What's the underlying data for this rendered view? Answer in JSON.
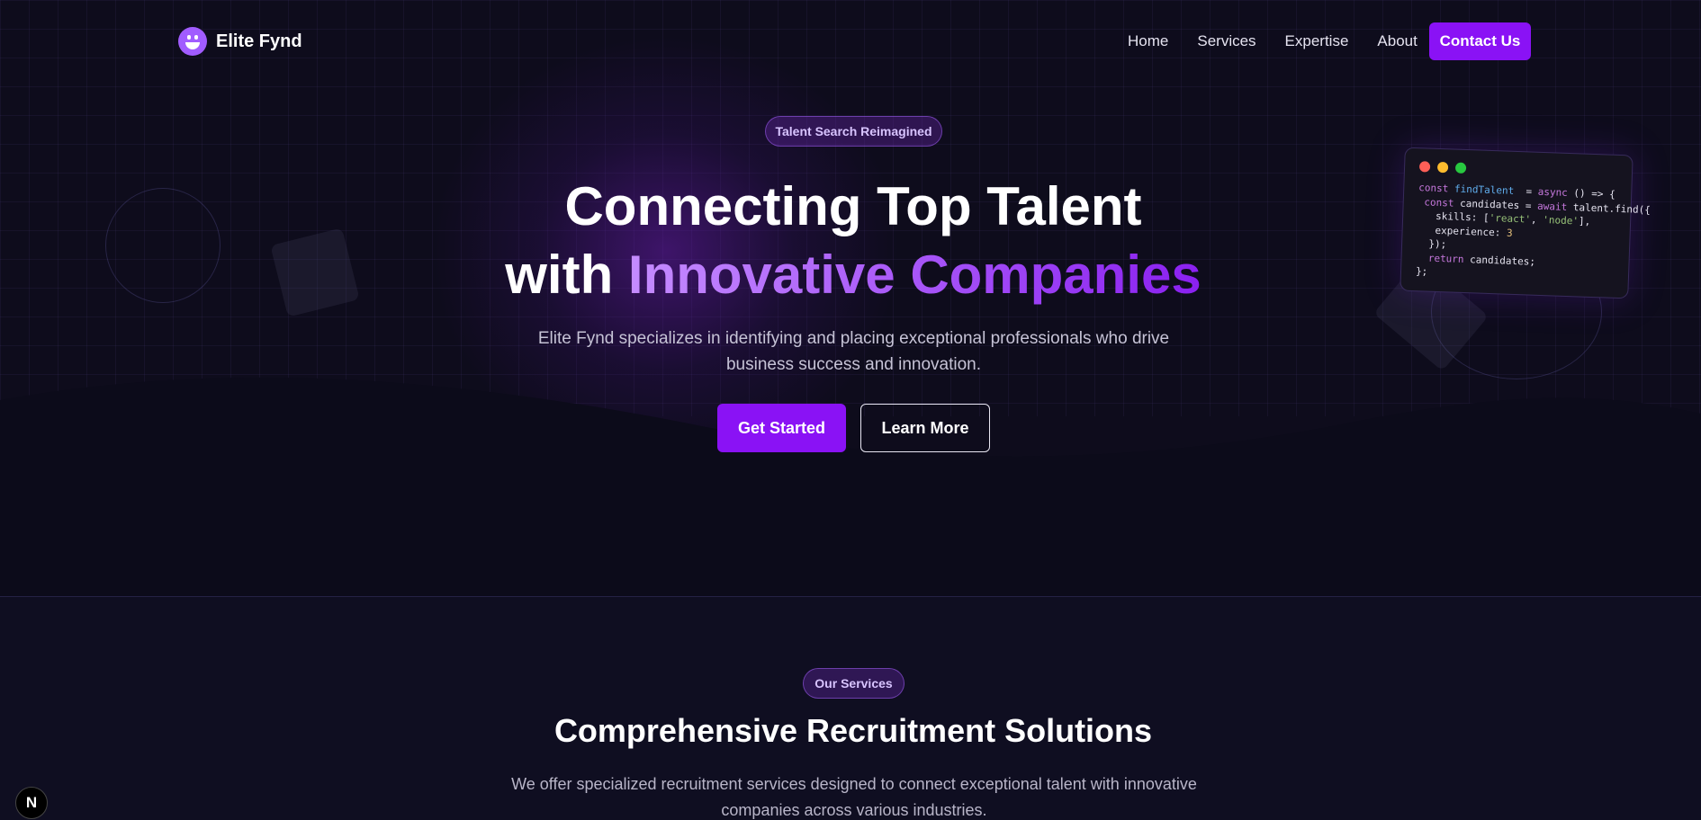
{
  "brand": {
    "name": "Elite Fynd",
    "logo_icon": "smiley-icon"
  },
  "nav": {
    "links": [
      "Home",
      "Services",
      "Expertise",
      "About"
    ],
    "contact_label": "Contact Us"
  },
  "hero": {
    "badge": "Talent Search Reimagined",
    "title_line1": "Connecting Top Talent",
    "title_line2_prefix": "with ",
    "title_line2_accent": "Innovative Companies",
    "subtitle": "Elite Fynd specializes in identifying and placing exceptional professionals who drive business success and innovation.",
    "primary_cta": "Get Started",
    "secondary_cta": "Learn More"
  },
  "code_card": {
    "lines": [
      [
        [
          "kw",
          "const "
        ],
        [
          "fn",
          "findTalent"
        ],
        [
          "",
          "  = "
        ],
        [
          "kw",
          "async"
        ],
        [
          "",
          " () => {"
        ]
      ],
      [
        [
          "",
          " "
        ],
        [
          "kw",
          "const"
        ],
        [
          "",
          " candidates = "
        ],
        [
          "kw",
          "await"
        ],
        [
          "",
          " talent.find({"
        ]
      ],
      [
        [
          "",
          "   skills: ["
        ],
        [
          "str",
          "'react'"
        ],
        [
          "",
          ", "
        ],
        [
          "str",
          "'node'"
        ],
        [
          "",
          "],"
        ]
      ],
      [
        [
          "",
          "   experience: "
        ],
        [
          "num",
          "3"
        ]
      ],
      [
        [
          "",
          "  });"
        ]
      ],
      [
        [
          "",
          "  "
        ],
        [
          "kw",
          "return"
        ],
        [
          "",
          " candidates;"
        ]
      ],
      [
        [
          "",
          "};"
        ]
      ]
    ],
    "dot_colors": [
      "#ff5f57",
      "#febc2e",
      "#28c840"
    ]
  },
  "services": {
    "badge": "Our Services",
    "title": "Comprehensive Recruitment Solutions",
    "subtitle": "We offer specialized recruitment services designed to connect exceptional talent with innovative companies across various industries."
  },
  "dev_badge": "N",
  "colors": {
    "accent": "#8a12f5",
    "background": "#0c0b1a"
  }
}
